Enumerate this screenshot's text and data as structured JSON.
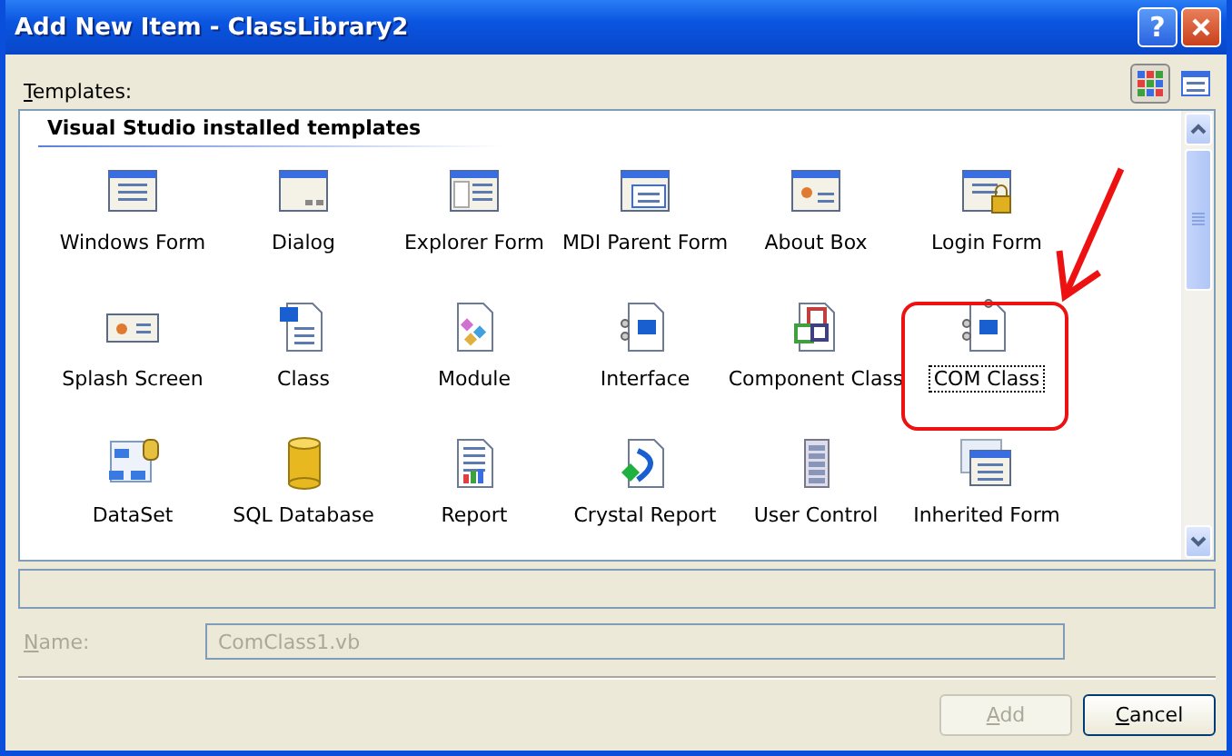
{
  "window": {
    "title": "Add New Item - ClassLibrary2",
    "help": "?"
  },
  "templates_label": "Templates:",
  "views": [
    {
      "selected": true
    },
    {
      "selected": false
    }
  ],
  "section_header": "Visual Studio installed templates",
  "items": [
    {
      "label": "Windows Form",
      "selected": false
    },
    {
      "label": "Dialog",
      "selected": false
    },
    {
      "label": "Explorer Form",
      "selected": false
    },
    {
      "label": "MDI Parent Form",
      "selected": false
    },
    {
      "label": "About Box",
      "selected": false
    },
    {
      "label": "Login Form",
      "selected": false
    },
    {
      "label": "Splash Screen",
      "selected": false
    },
    {
      "label": "Class",
      "selected": false
    },
    {
      "label": "Module",
      "selected": false
    },
    {
      "label": "Interface",
      "selected": false
    },
    {
      "label": "Component Class",
      "selected": false
    },
    {
      "label": "COM Class",
      "selected": true
    },
    {
      "label": "DataSet",
      "selected": false
    },
    {
      "label": "SQL Database",
      "selected": false
    },
    {
      "label": "Report",
      "selected": false
    },
    {
      "label": "Crystal Report",
      "selected": false
    },
    {
      "label": "User Control",
      "selected": false
    },
    {
      "label": "Inherited Form",
      "selected": false
    }
  ],
  "name": {
    "label": "Name:",
    "value": "ComClass1.vb",
    "disabled": true
  },
  "buttons": [
    {
      "label": "Add",
      "disabled": true
    },
    {
      "label": "Cancel",
      "disabled": false
    }
  ]
}
